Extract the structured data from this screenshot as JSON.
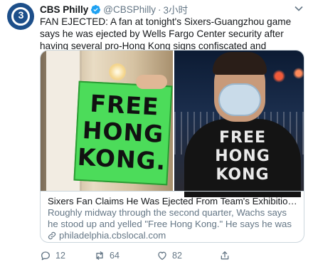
{
  "account": {
    "name": "CBS Philly",
    "handle": "@CBSPhilly",
    "separator": "·",
    "time": "3小时",
    "avatar_text": "3"
  },
  "tweet": {
    "text": "FAN EJECTED: A fan at tonight's Sixers-Guangzhou game says he was ejected by Wells Fargo Center security after having several pro-Hong Kong signs confiscated and repeatedly yelling \"Free Hong Kong.\""
  },
  "card": {
    "sign_lines": [
      "FREE",
      "HONG",
      "KONG."
    ],
    "shirt_lines": [
      "FREE",
      "HONG",
      "KONG"
    ],
    "title": "Sixers Fan Claims He Was Ejected From Team's Exhibition Vs. Chin...",
    "description": "Roughly midway through the second quarter, Wachs says he stood up and yelled \"Free Hong Kong.\" He says he was then ejected fro...",
    "link": "philadelphia.cbslocal.com"
  },
  "actions": {
    "replies": "12",
    "retweets": "64",
    "likes": "82"
  },
  "colors": {
    "verified": "#1da1f2",
    "muted": "#657786",
    "sign_green": "#4cdc5a"
  }
}
